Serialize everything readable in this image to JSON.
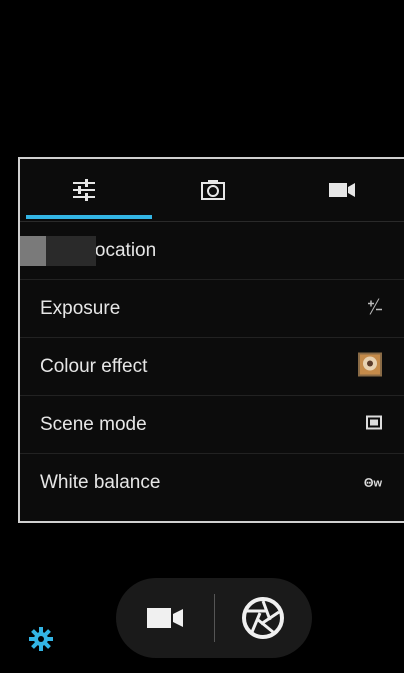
{
  "tabs": [
    {
      "icon": "sliders-icon"
    },
    {
      "icon": "camera-icon"
    },
    {
      "icon": "video-camera-icon"
    }
  ],
  "settings": [
    {
      "label": "Store location",
      "control": "toggle",
      "value": "off",
      "icon": "toggle-switch"
    },
    {
      "label": "Exposure",
      "control": "icon",
      "icon": "exposure-icon"
    },
    {
      "label": "Colour effect",
      "control": "icon",
      "icon": "colour-effect-icon"
    },
    {
      "label": "Scene mode",
      "control": "icon",
      "icon": "scene-mode-icon"
    },
    {
      "label": "White balance",
      "control": "icon",
      "icon": "white-balance-auto-icon",
      "icon_text": "Ꙫw"
    }
  ],
  "bottom_controls": [
    {
      "icon": "video-camera-icon"
    },
    {
      "icon": "shutter-icon"
    }
  ],
  "settings_button": {
    "icon": "gear-icon"
  },
  "colors": {
    "accent": "#33b5e5",
    "background": "#000000",
    "panel": "#0c0c0c",
    "text": "#e6e6e6"
  }
}
